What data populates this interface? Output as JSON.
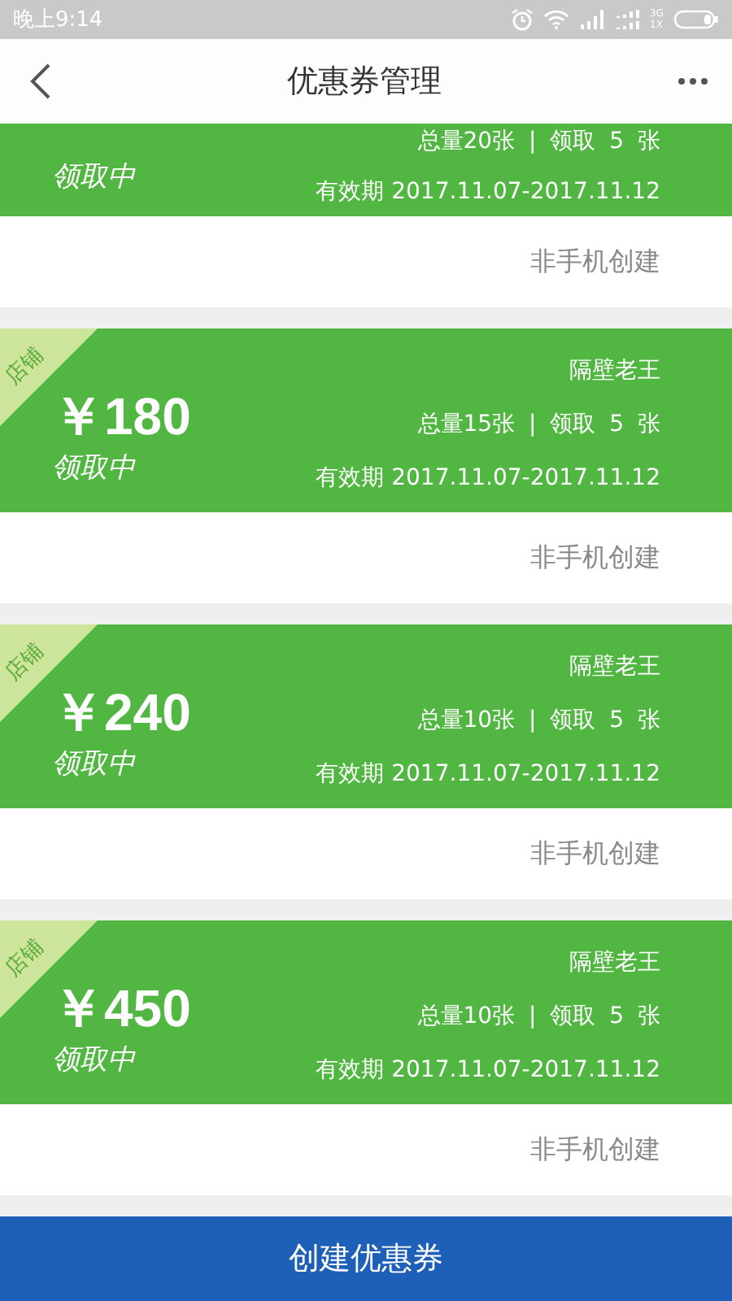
{
  "status_bar": {
    "time": "晚上9:14",
    "network": "3G",
    "network_sub": "1X"
  },
  "header": {
    "title": "优惠券管理"
  },
  "coupons": [
    {
      "kind": "partial",
      "status": "领取中",
      "total": "总量20张 | 领取 5 张",
      "validity": "有效期 2017.11.07-2017.11.12",
      "origin": "非手机创建"
    },
    {
      "kind": "full",
      "tag": "店铺",
      "amount": "￥180",
      "status": "领取中",
      "shop": "隔壁老王",
      "total": "总量15张 | 领取 5 张",
      "validity": "有效期 2017.11.07-2017.11.12",
      "origin": "非手机创建"
    },
    {
      "kind": "full",
      "tag": "店铺",
      "amount": "￥240",
      "status": "领取中",
      "shop": "隔壁老王",
      "total": "总量10张 | 领取 5 张",
      "validity": "有效期 2017.11.07-2017.11.12",
      "origin": "非手机创建"
    },
    {
      "kind": "full",
      "tag": "店铺",
      "amount": "￥450",
      "status": "领取中",
      "shop": "隔壁老王",
      "total": "总量10张 | 领取 5 张",
      "validity": "有效期 2017.11.07-2017.11.12",
      "origin": "非手机创建"
    }
  ],
  "create_button": "创建优惠券"
}
